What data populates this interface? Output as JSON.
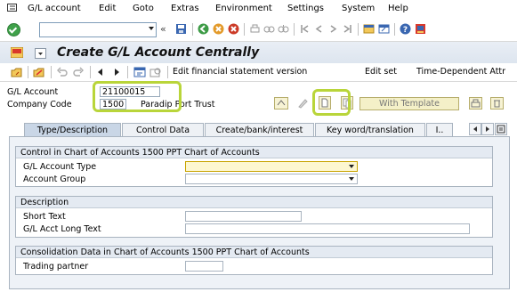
{
  "menu": {
    "items": [
      "G/L account",
      "Edit",
      "Goto",
      "Extras",
      "Environment",
      "Settings",
      "System",
      "Help"
    ]
  },
  "command": {
    "value": ""
  },
  "title": "Create G/L Account Centrally",
  "app_toolbar": {
    "edit_fs_version": "Edit financial statement version",
    "edit_set": "Edit set",
    "time_dependent": "Time-Dependent Attr"
  },
  "header": {
    "gl_account_label": "G/L Account",
    "gl_account_value": "21100015",
    "company_code_label": "Company Code",
    "company_code_value": "1500",
    "company_name": "Paradip Port Trust",
    "with_template": "With Template"
  },
  "tabs": [
    "Type/Description",
    "Control Data",
    "Create/bank/interest",
    "Key word/translation",
    "I.."
  ],
  "control": {
    "title": "Control in Chart of Accounts 1500 PPT Chart of Accounts",
    "account_type_label": "G/L Account Type",
    "account_type_value": "",
    "account_group_label": "Account Group",
    "account_group_value": ""
  },
  "description": {
    "title": "Description",
    "short_text_label": "Short Text",
    "short_text_value": "",
    "long_text_label": "G/L Acct Long Text",
    "long_text_value": ""
  },
  "consolidation": {
    "title": "Consolidation Data in Chart of Accounts 1500 PPT Chart of Accounts",
    "trading_partner_label": "Trading partner",
    "trading_partner_value": ""
  },
  "colors": {
    "highlight": "#b9d53a",
    "ok": "#3fa14a",
    "title_bg": "#dde5ef"
  }
}
